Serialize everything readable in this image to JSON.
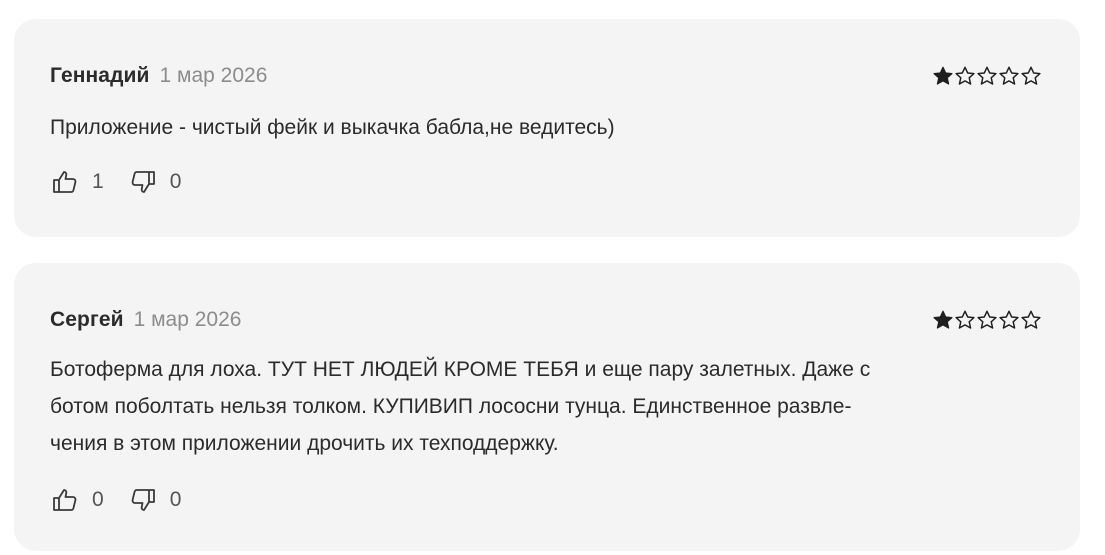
{
  "reviews": [
    {
      "author": "Геннадий",
      "date": "1 мар 2026",
      "rating": 1,
      "text": "Приложение - чистый фейк и выкачка бабла,не ведитесь)",
      "likes": "1",
      "dislikes": "0"
    },
    {
      "author": "Сергей",
      "date": "1 мар 2026",
      "rating": 1,
      "text_lines": [
        "Ботоферма для лоха. ТУТ НЕТ ЛЮДЕЙ КРОМЕ ТЕБЯ и еще пару залетных. Даже с",
        "ботом поболтать нельзя толком. КУПИВИП лососни тунца. Единственное развле-",
        "чения в этом приложении дрочить их техподдержку."
      ],
      "likes": "0",
      "dislikes": "0"
    }
  ],
  "icons": {
    "like": "thumbs-up-icon",
    "dislike": "thumbs-down-icon",
    "star_filled": "star-filled-icon",
    "star_empty": "star-empty-icon"
  },
  "colors": {
    "card_bg": "#f4f4f4",
    "text": "#2b2b2b",
    "muted": "#8c8c8c"
  }
}
